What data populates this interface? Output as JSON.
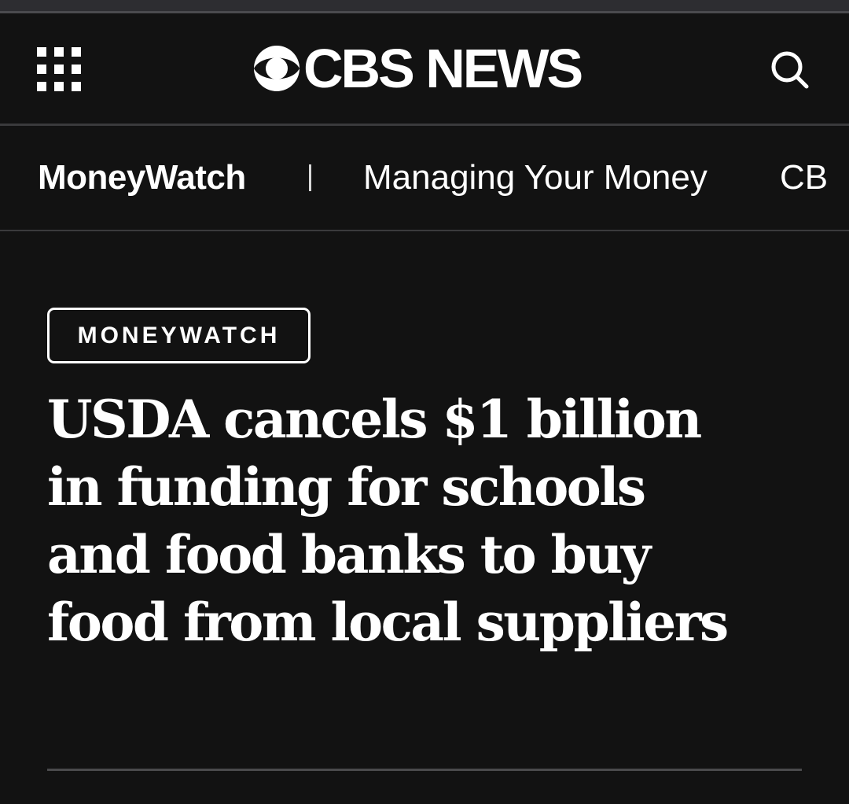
{
  "header": {
    "logo_text": "CBS NEWS",
    "menu_icon": "grid-menu-icon",
    "search_icon": "search-icon"
  },
  "subnav": {
    "section": "MoneyWatch",
    "separator": "|",
    "links": [
      "Managing Your Money",
      "CB"
    ]
  },
  "article": {
    "category": "MONEYWATCH",
    "headline": "USDA cancels $1 billion in funding for schools and food banks to buy food from local suppliers"
  },
  "colors": {
    "background": "#121212",
    "text": "#ffffff",
    "divider": "#3a3a3c"
  }
}
